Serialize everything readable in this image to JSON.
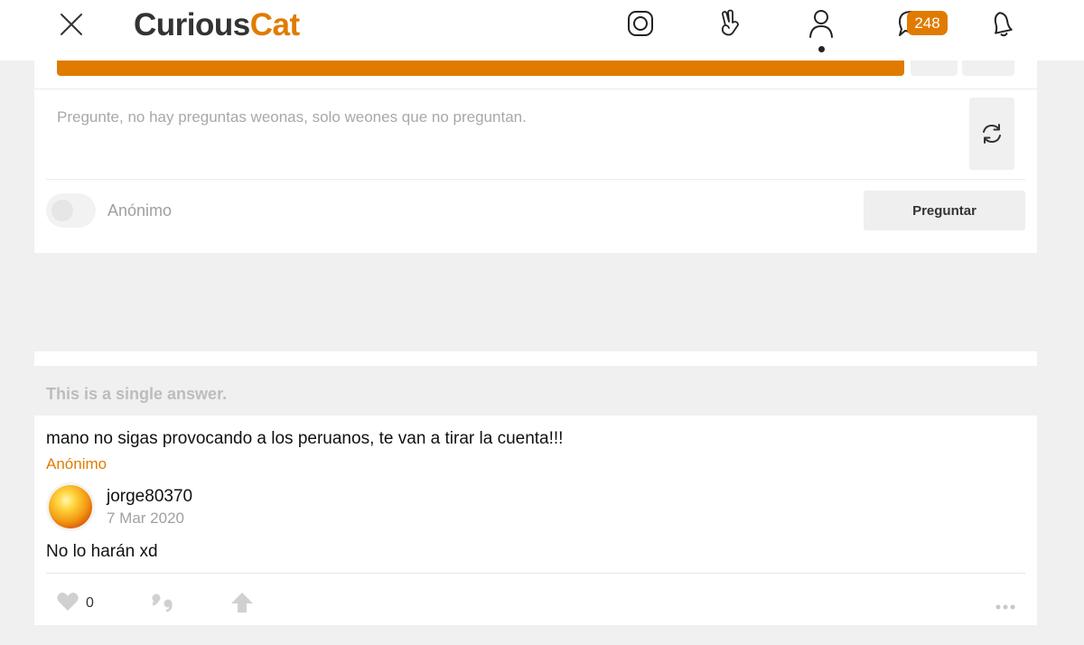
{
  "header": {
    "logo_part1": "Curious",
    "logo_part2": "Cat",
    "notifications_badge": "248",
    "icons": [
      "close-icon",
      "instagram-icon",
      "peace-hand-icon",
      "profile-icon",
      "chat-icon",
      "bell-icon"
    ]
  },
  "ask": {
    "placeholder": "Pregunte, no hay preguntas weonas, solo weones que no preguntan.",
    "anonymous_label": "Anónimo",
    "ask_button_label": "Preguntar"
  },
  "answer_section": {
    "label": "This is a single answer.",
    "question": "mano no sigas provocando a los peruanos, te van a tirar la cuenta!!!",
    "asker": "Anónimo",
    "author": {
      "username": "jorge80370",
      "date": "7 Mar 2020"
    },
    "answer": "No lo harán xd",
    "likes": "0"
  },
  "colors": {
    "accent": "#e07b00",
    "background": "#f0f0f0",
    "card": "#ffffff"
  }
}
